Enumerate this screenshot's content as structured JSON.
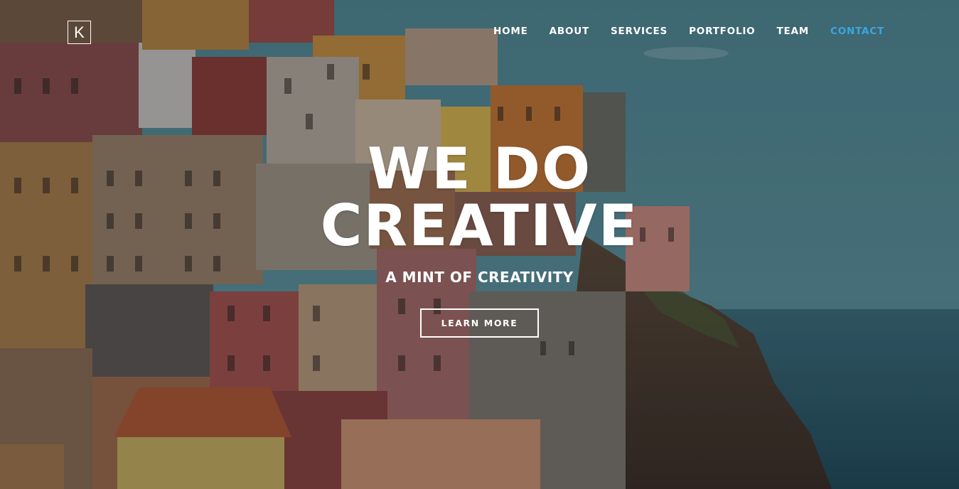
{
  "brand": {
    "logo_letter": "K"
  },
  "nav": {
    "items": [
      {
        "label": "HOME"
      },
      {
        "label": "ABOUT"
      },
      {
        "label": "SERVICES"
      },
      {
        "label": "PORTFOLIO"
      },
      {
        "label": "TEAM"
      },
      {
        "label": "CONTACT"
      }
    ],
    "active_label": "CONTACT",
    "active_color": "#3aa7e0"
  },
  "hero": {
    "headline_line1": "WE DO",
    "headline_line2": "CREATIVE",
    "tagline": "A MINT OF CREATIVITY",
    "cta_label": "LEARN MORE",
    "background_image": "cliffside coastal village with colorful houses overlooking the sea"
  }
}
